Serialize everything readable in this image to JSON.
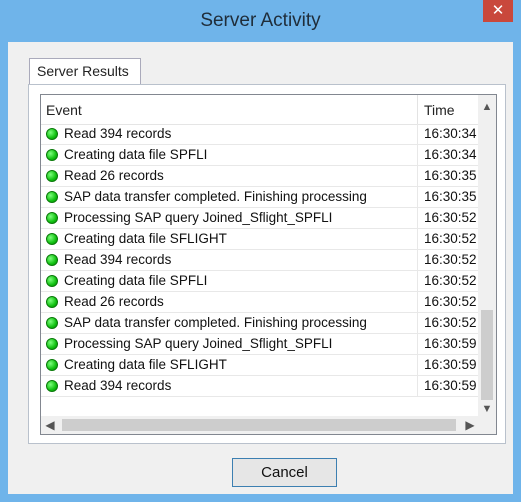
{
  "window": {
    "title": "Server Activity",
    "close_label": "✕"
  },
  "tabs": [
    {
      "label": "Server Results"
    }
  ],
  "list": {
    "columns": {
      "event": "Event",
      "time": "Time"
    },
    "rows": [
      {
        "event": "Read 394 records",
        "time": "16:30:34 ..."
      },
      {
        "event": "Creating data file SPFLI",
        "time": "16:30:34 ..."
      },
      {
        "event": "Read 26 records",
        "time": "16:30:35 ..."
      },
      {
        "event": "SAP data transfer completed. Finishing processing",
        "time": "16:30:35 ..."
      },
      {
        "event": "Processing SAP query Joined_Sflight_SPFLI",
        "time": "16:30:52 ..."
      },
      {
        "event": "Creating data file SFLIGHT",
        "time": "16:30:52 ..."
      },
      {
        "event": "Read 394 records",
        "time": "16:30:52 ..."
      },
      {
        "event": "Creating data file SPFLI",
        "time": "16:30:52 ..."
      },
      {
        "event": "Read 26 records",
        "time": "16:30:52 ..."
      },
      {
        "event": "SAP data transfer completed. Finishing processing",
        "time": "16:30:52 ..."
      },
      {
        "event": "Processing SAP query Joined_Sflight_SPFLI",
        "time": "16:30:59 ..."
      },
      {
        "event": "Creating data file SFLIGHT",
        "time": "16:30:59 ..."
      },
      {
        "event": "Read 394 records",
        "time": "16:30:59 ..."
      }
    ],
    "status_color": "#10c010"
  },
  "buttons": {
    "cancel": "Cancel"
  }
}
